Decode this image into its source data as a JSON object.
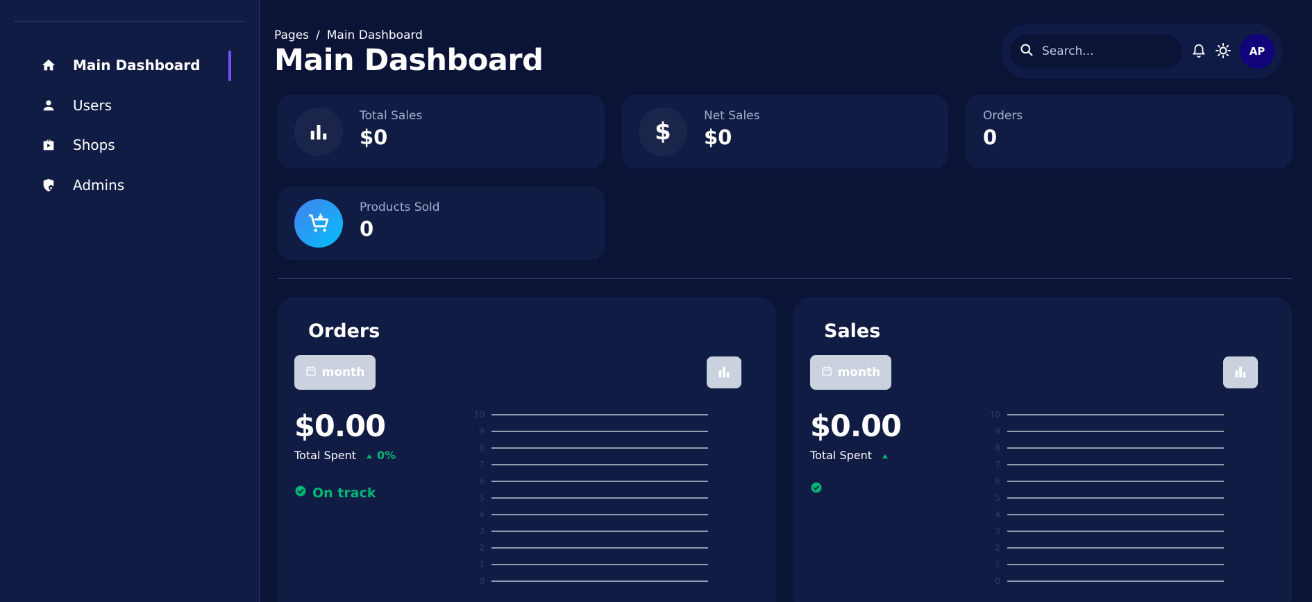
{
  "sidebar": {
    "items": [
      {
        "label": "Main Dashboard",
        "icon": "home-icon",
        "active": true
      },
      {
        "label": "Users",
        "icon": "person-icon",
        "active": false
      },
      {
        "label": "Shops",
        "icon": "briefcase-play-icon",
        "active": false
      },
      {
        "label": "Admins",
        "icon": "shield-lock-icon",
        "active": false
      }
    ]
  },
  "header": {
    "breadcrumb_root": "Pages",
    "breadcrumb_sep": "/",
    "breadcrumb_current": "Main Dashboard",
    "title": "Main Dashboard",
    "search_placeholder": "Search...",
    "avatar_initials": "AP"
  },
  "stats": [
    {
      "label": "Total Sales",
      "value": "$0",
      "icon": "bar-chart-icon"
    },
    {
      "label": "Net Sales",
      "value": "$0",
      "icon": "dollar-icon"
    },
    {
      "label": "Orders",
      "value": "0",
      "icon": ""
    },
    {
      "label": "Products Sold",
      "value": "0",
      "icon": "cart-icon"
    }
  ],
  "panels": {
    "orders": {
      "title": "Orders",
      "period_label": "month",
      "value": "$0.00",
      "caption": "Total Spent",
      "trend": "0%",
      "status": "On track"
    },
    "sales": {
      "title": "Sales",
      "period_label": "month",
      "value": "$0.00",
      "caption": "Total Spent",
      "trend": "",
      "status": ""
    }
  },
  "colors": {
    "background": "#0b1437",
    "card": "#111c44",
    "accent": "#7551ff",
    "success": "#01b574",
    "button": "#c9d2de"
  },
  "chart_data": [
    {
      "type": "line",
      "title": "",
      "y_ticks": [
        10,
        9,
        8,
        7,
        6,
        5,
        4,
        3,
        2,
        1,
        0
      ],
      "ylim": [
        0,
        10
      ],
      "grid": true,
      "series": []
    },
    {
      "type": "line",
      "title": "",
      "y_ticks": [
        10,
        9,
        8,
        7,
        6,
        5,
        4,
        3,
        2,
        1,
        0
      ],
      "ylim": [
        0,
        10
      ],
      "grid": true,
      "series": []
    }
  ]
}
